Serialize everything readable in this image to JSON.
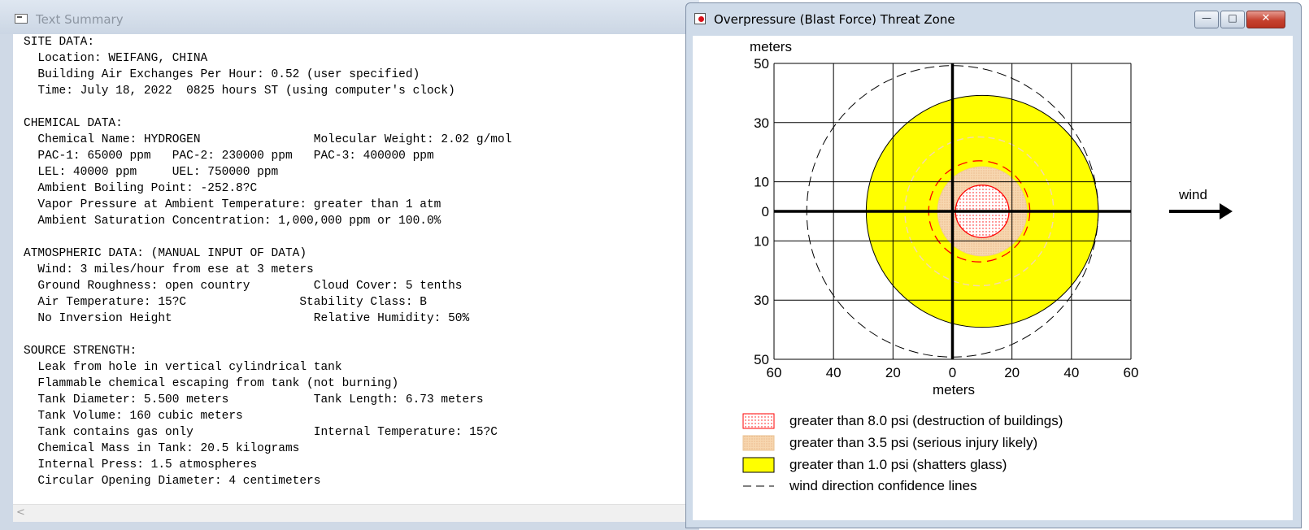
{
  "text_window": {
    "title": "Text Summary",
    "lines": [
      "SITE DATA:",
      "  Location: WEIFANG, CHINA",
      "  Building Air Exchanges Per Hour: 0.52 (user specified)",
      "  Time: July 18, 2022  0825 hours ST (using computer's clock)",
      "",
      "CHEMICAL DATA:",
      "  Chemical Name: HYDROGEN                Molecular Weight: 2.02 g/mol",
      "  PAC-1: 65000 ppm   PAC-2: 230000 ppm   PAC-3: 400000 ppm",
      "  LEL: 40000 ppm     UEL: 750000 ppm",
      "  Ambient Boiling Point: -252.8?C",
      "  Vapor Pressure at Ambient Temperature: greater than 1 atm",
      "  Ambient Saturation Concentration: 1,000,000 ppm or 100.0%",
      "",
      "ATMOSPHERIC DATA: (MANUAL INPUT OF DATA)",
      "  Wind: 3 miles/hour from ese at 3 meters",
      "  Ground Roughness: open country         Cloud Cover: 5 tenths",
      "  Air Temperature: 15?C                Stability Class: B",
      "  No Inversion Height                    Relative Humidity: 50%",
      "",
      "SOURCE STRENGTH:",
      "  Leak from hole in vertical cylindrical tank",
      "  Flammable chemical escaping from tank (not burning)",
      "  Tank Diameter: 5.500 meters            Tank Length: 6.73 meters",
      "  Tank Volume: 160 cubic meters",
      "  Tank contains gas only                 Internal Temperature: 15?C",
      "  Chemical Mass in Tank: 20.5 kilograms",
      "  Internal Press: 1.5 atmospheres",
      "  Circular Opening Diameter: 4 centimeters"
    ],
    "scroll_left_glyph": "<"
  },
  "threat_window": {
    "title": "Overpressure (Blast Force) Threat Zone",
    "buttons": {
      "minimize": "—",
      "maximize": "□",
      "close": "✕"
    },
    "wind_label": "wind",
    "legend": [
      {
        "label": "greater than 8.0 psi (destruction of buildings)",
        "swatch": "dotted-red"
      },
      {
        "label": "greater than 3.5 psi (serious injury likely)",
        "swatch": "dotted-orange"
      },
      {
        "label": "greater than 1.0 psi (shatters glass)",
        "swatch": "yellow"
      },
      {
        "label": "wind direction confidence lines",
        "swatch": "dash"
      }
    ]
  },
  "colors": {
    "zone_1psi": "#ffff00",
    "zone_3_5psi": "#f7dcbc",
    "zone_8psi": "#ff0000",
    "confidence_line": "#000000"
  },
  "chart_data": {
    "type": "map",
    "xlabel": "meters",
    "ylabel": "meters",
    "xlim": [
      -60,
      60
    ],
    "ylim": [
      -50,
      50
    ],
    "x_ticks": [
      60,
      40,
      20,
      0,
      20,
      40,
      60
    ],
    "y_ticks": [
      50,
      30,
      10,
      0,
      10,
      30,
      50
    ],
    "zones": [
      {
        "name": "greater than 1.0 psi (shatters glass)",
        "center_x": 10,
        "center_y": 0,
        "radius": 39
      },
      {
        "name": "greater than 3.5 psi (serious injury likely)",
        "center_x": 10,
        "center_y": 0,
        "radius": 15
      },
      {
        "name": "greater than 8.0 psi (destruction of buildings)",
        "center_x": 10,
        "center_y": 0,
        "radius": 9
      }
    ],
    "confidence_radius": 49,
    "grid": true
  }
}
